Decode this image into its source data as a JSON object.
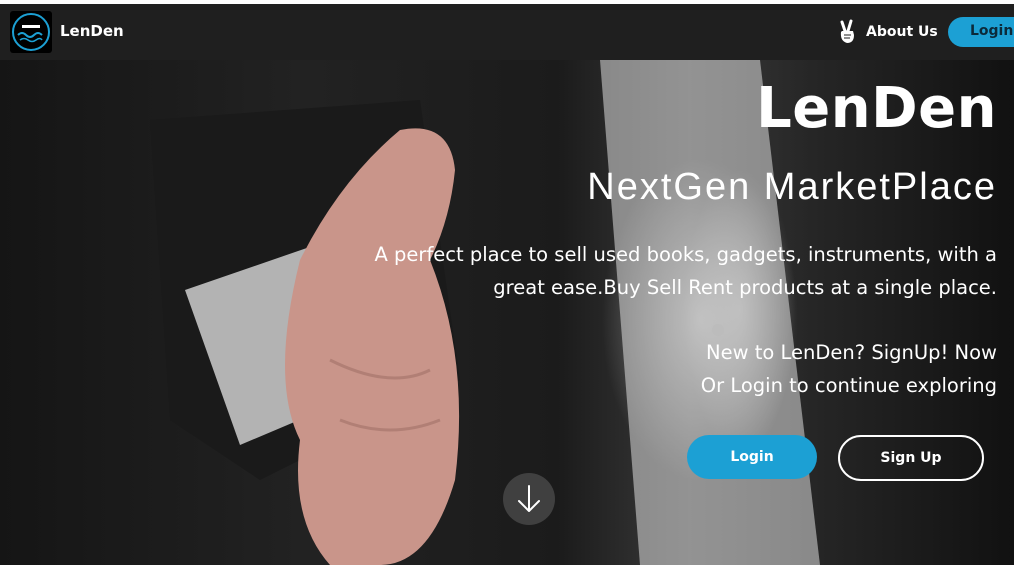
{
  "navbar": {
    "brand": "LenDen",
    "about_label": "About Us",
    "login_label": "Login",
    "icons": {
      "about": "peace-hand-icon",
      "logo": "lenden-logo"
    }
  },
  "hero": {
    "title": "LenDen",
    "subtitle": "NextGen MarketPlace",
    "description_line1": "A perfect place to sell used books, gadgets, instruments, with a",
    "description_line2": "great ease.Buy Sell Rent products at a single place.",
    "cta_line1": "New to LenDen? SignUp! Now",
    "cta_line2": "Or Login to continue exploring",
    "login_button": "Login",
    "signup_button": "Sign Up",
    "scroll_icon": "arrow-down-icon"
  },
  "colors": {
    "accent": "#1ca0d4",
    "navbar_bg": "#1f1f1f",
    "text": "#ffffff"
  }
}
